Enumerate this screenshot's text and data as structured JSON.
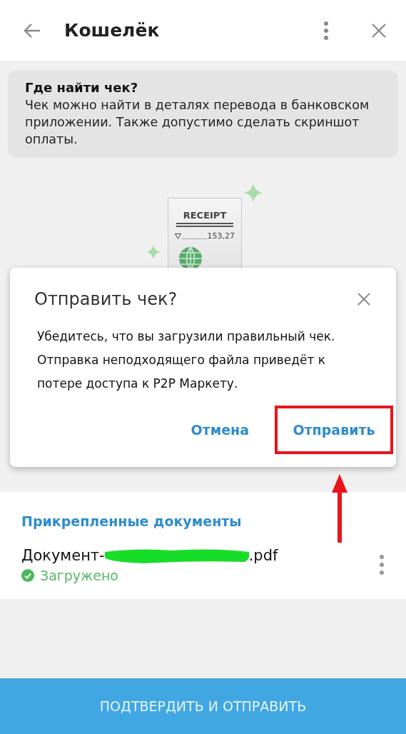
{
  "header": {
    "title": "Кошелёк"
  },
  "info": {
    "title": "Где найти чек?",
    "text": "Чек можно найти в деталях перевода в банковском приложении. Также допустимо сделать скриншот оплаты."
  },
  "receipt": {
    "title": "RECEIPT",
    "amount": "153,27"
  },
  "dialog": {
    "title": "Отправить чек?",
    "text": "Убедитесь, что вы загрузили правильный чек. Отправка неподходящего файла приведёт к потере доступа к P2P Маркету.",
    "buttons": [
      {
        "label": "Отмена",
        "highlighted": false
      },
      {
        "label": "Отправить",
        "highlighted": true
      }
    ]
  },
  "documents": {
    "title": "Прикрепленные документы",
    "items": [
      {
        "name_start": "Документ-",
        "name_end": ".pdf",
        "redacted": true,
        "status": "Загружено"
      }
    ]
  },
  "confirm_button": "ПОДТВЕРДИТЬ И ОТПРАВИТЬ"
}
